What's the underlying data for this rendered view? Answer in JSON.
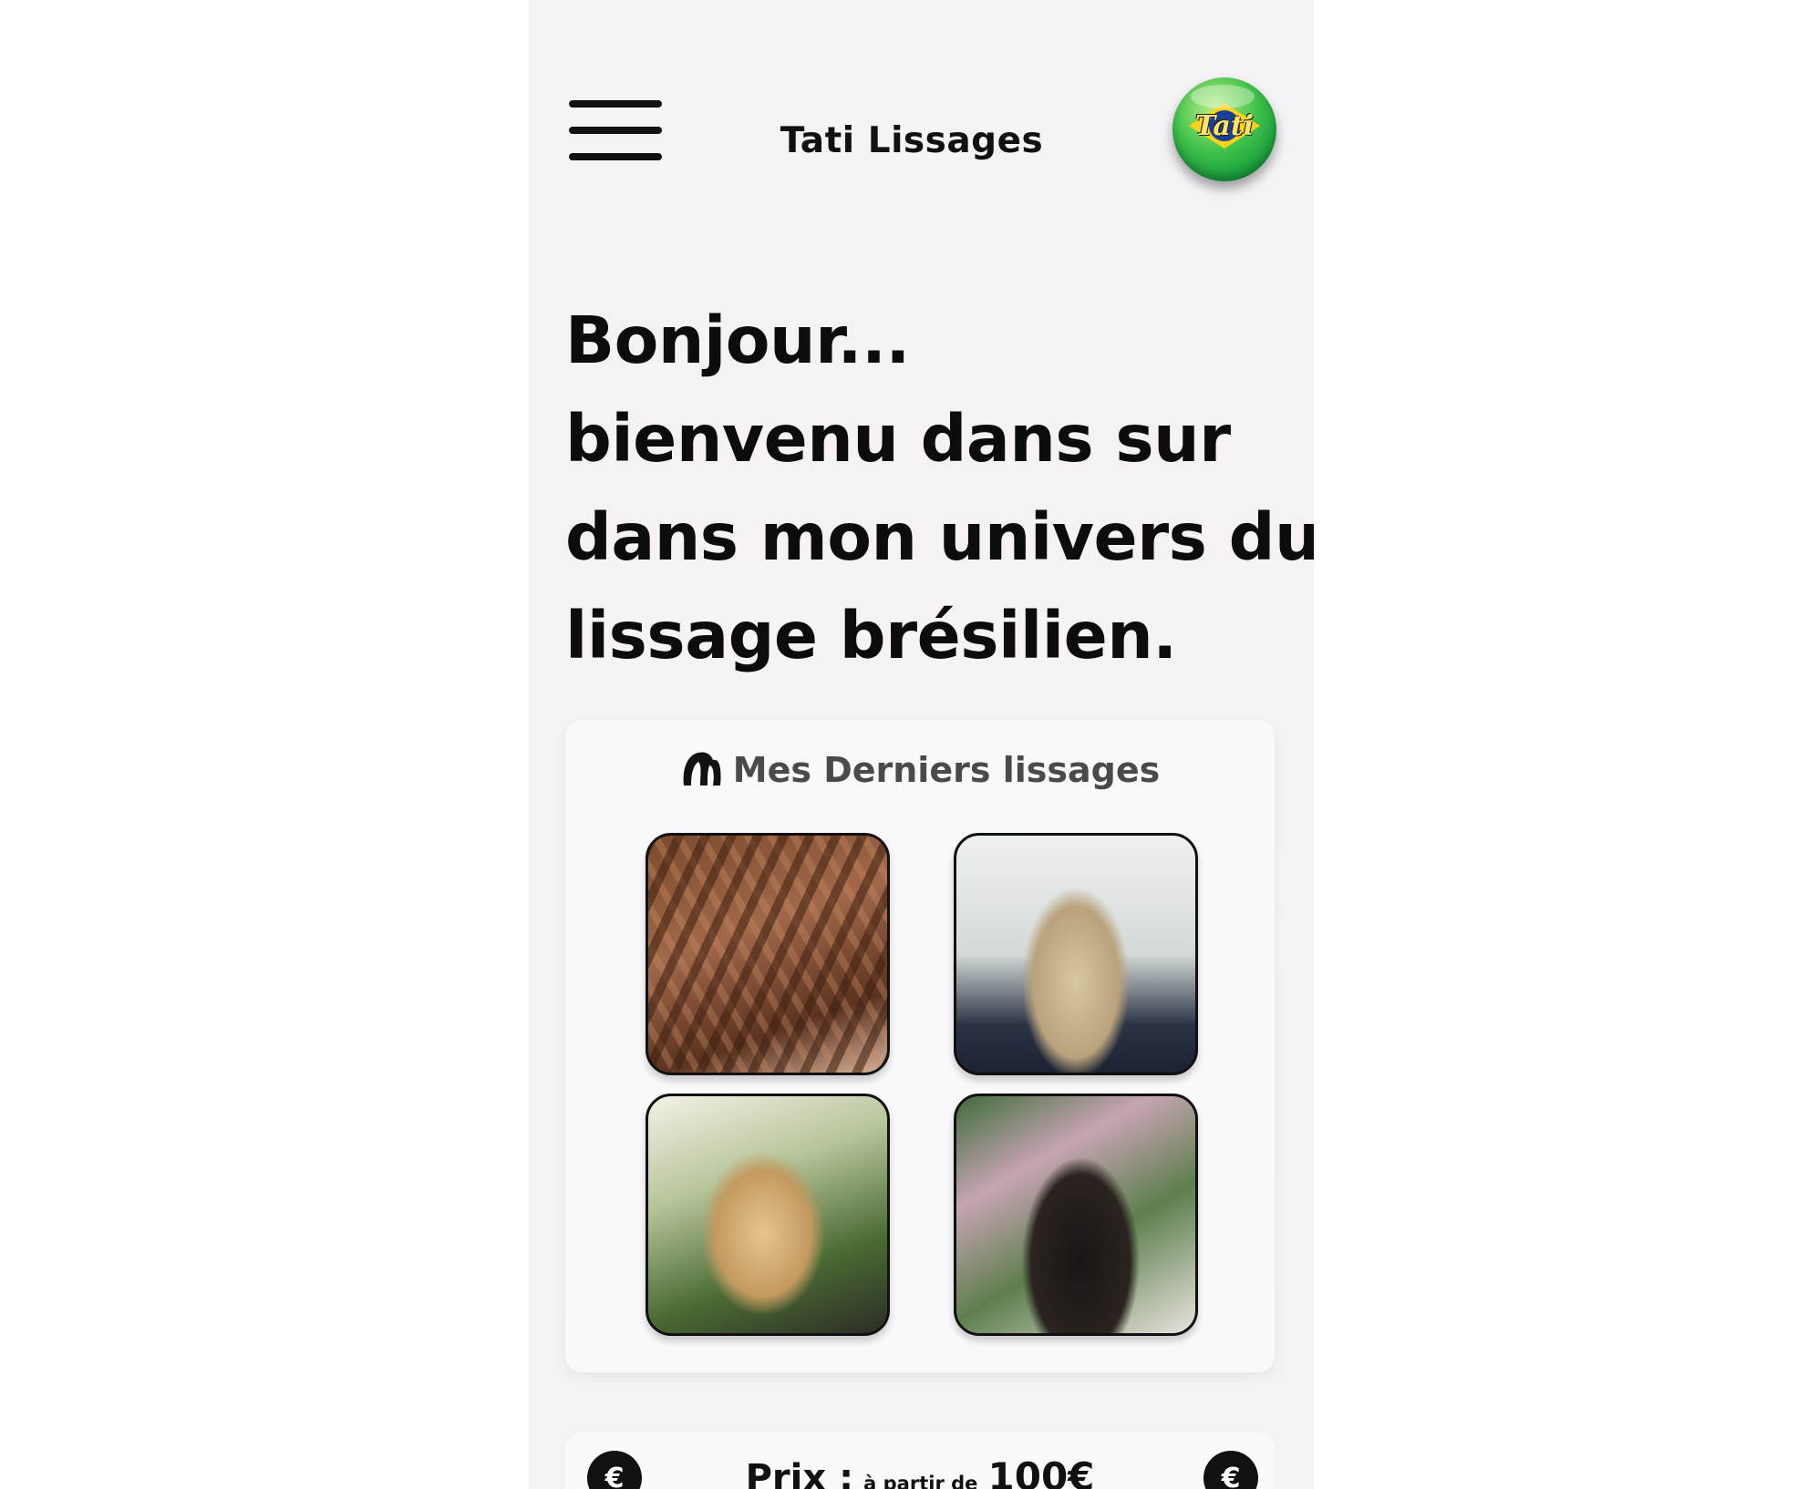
{
  "header": {
    "brand": "Tati Lissages",
    "logo_text": "Tati",
    "menu_icon": "hamburger-menu-icon"
  },
  "hero": {
    "lines": [
      "Bonjour...",
      "bienvenu dans sur",
      "dans mon univers du",
      "lissage brésilien."
    ]
  },
  "gallery": {
    "title": "Mes Derniers lissages",
    "icon": "hair-icon",
    "items": [
      {
        "alt": "cheveux bouclés bruns"
      },
      {
        "alt": "cheveux longs blonds méchés"
      },
      {
        "alt": "cheveux blonds ondulés"
      },
      {
        "alt": "cheveux longs bruns lisses"
      }
    ]
  },
  "price": {
    "label": "Prix :",
    "from": "à partir de",
    "value": "100€",
    "icon": "euro-icon"
  }
}
